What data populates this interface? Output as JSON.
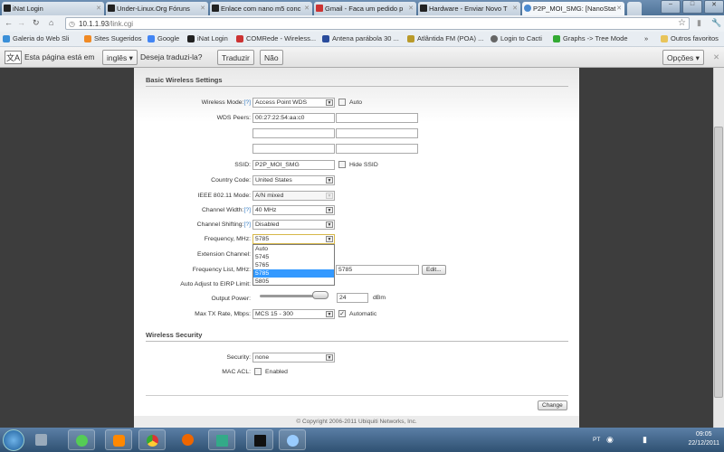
{
  "browser": {
    "tabs": [
      {
        "title": "iNat Login",
        "active": false
      },
      {
        "title": "Under-Linux.Org Fóruns",
        "active": false
      },
      {
        "title": "Enlace com nano m5 conc",
        "active": false
      },
      {
        "title": "Gmail - Faca um pedido p",
        "active": false
      },
      {
        "title": "Hardware - Enviar Novo T",
        "active": false
      },
      {
        "title": "P2P_MOI_SMG: [NanoStat",
        "active": true
      }
    ],
    "url_host": "10.1.1.93",
    "url_path": "/link.cgi",
    "bookmarks": [
      "Galeria do Web Sli",
      "Sites Sugeridos",
      "Google",
      "iNat Login",
      "COMRede - Wireless...",
      "Antena parábola 30 ...",
      "Atlântida FM (POA) ...",
      "Login to Cacti",
      "Graphs -> Tree Mode"
    ],
    "bookmarks_overflow": "»",
    "other_bookmarks": "Outros favoritos"
  },
  "translate_bar": {
    "prefix": "Esta página está em",
    "language": "inglês",
    "question": "Deseja traduzi-la?",
    "translate": "Traduzir",
    "no": "Não",
    "options": "Opções"
  },
  "basic": {
    "title": "Basic Wireless Settings",
    "wireless_mode": {
      "label": "Wireless Mode:",
      "help": "[?]",
      "value": "Access Point WDS",
      "auto_label": "Auto",
      "auto": false
    },
    "wds_peers": {
      "label": "WDS Peers:",
      "values": [
        "00:27:22:54:aa:c0",
        "",
        "",
        "",
        "",
        ""
      ]
    },
    "ssid": {
      "label": "SSID:",
      "value": "P2P_MOI_SMG",
      "hide_label": "Hide SSID",
      "hide": false
    },
    "country": {
      "label": "Country Code:",
      "value": "United States"
    },
    "ieee_mode": {
      "label": "IEEE 802.11 Mode:",
      "value": "A/N mixed"
    },
    "channel_width": {
      "label": "Channel Width:",
      "help": "[?]",
      "value": "40 MHz"
    },
    "channel_shifting": {
      "label": "Channel Shifting:",
      "help": "[?]",
      "value": "Disabled"
    },
    "frequency": {
      "label": "Frequency, MHz:",
      "value": "5785",
      "options": [
        "Auto",
        "5745",
        "5765",
        "5785",
        "5805"
      ],
      "selected_index": 3
    },
    "extension_channel": {
      "label": "Extension Channel:"
    },
    "frequency_list": {
      "label": "Frequency List, MHz:",
      "value": "5785",
      "edit": "Edit..."
    },
    "eirp": {
      "label": "Auto Adjust to EIRP Limit:"
    },
    "output_power": {
      "label": "Output Power:",
      "value": "24",
      "unit": "dBm",
      "slider_fraction": 0.95
    },
    "max_tx": {
      "label": "Max TX Rate, Mbps:",
      "value": "MCS 15 - 300",
      "auto_label": "Automatic",
      "auto": true
    }
  },
  "security": {
    "title": "Wireless Security",
    "security": {
      "label": "Security:",
      "value": "none"
    },
    "mac_acl": {
      "label": "MAC ACL:",
      "enabled_label": "Enabled",
      "enabled": false
    }
  },
  "change_button": "Change",
  "copyright": "© Copyright 2006-2011 Ubiquiti Networks, Inc.",
  "taskbar": {
    "lang": "PT",
    "time": "09:05",
    "date": "22/12/2011"
  }
}
